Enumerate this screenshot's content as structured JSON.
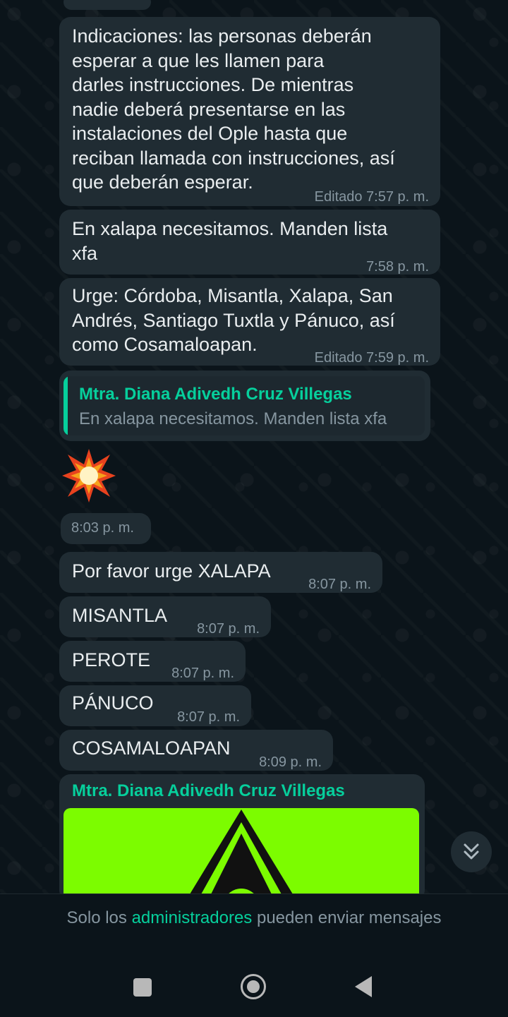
{
  "messages": [
    {
      "text": "Indicaciones: las personas deberán esperar a que les llamen para darles instrucciones. De mientras nadie deberá presentarse en las instalaciones del Ople hasta que reciban llamada con instrucciones, así que deberán esperar.",
      "lines": [
        "Indicaciones: las personas deberán",
        "esperar a que les llamen para",
        "darles instrucciones. De mientras",
        "nadie deberá presentarse en las",
        "instalaciones del Ople hasta que",
        "reciban llamada con instrucciones, así",
        "que deberán esperar."
      ],
      "time": "Editado 7:57 p. m."
    },
    {
      "lines": [
        "En xalapa necesitamos. Manden lista",
        "xfa"
      ],
      "time": "7:58 p. m."
    },
    {
      "lines": [
        "Urge: Córdoba, Misantla, Xalapa, San",
        "Andrés, Santiago Tuxtla y Pánuco, así",
        "como Cosamaloapan."
      ],
      "time": "Editado 7:59 p. m."
    }
  ],
  "reply": {
    "quoted_author": "Mtra. Diana Adivedh Cruz Villegas",
    "quoted_text": "En xalapa necesitamos. Manden lista xfa",
    "emoji": "collision-emoji",
    "time": "8:03 p. m."
  },
  "short_messages": [
    {
      "text": "Por favor urge XALAPA",
      "time": "8:07 p. m."
    },
    {
      "text": "MISANTLA",
      "time": "8:07 p. m."
    },
    {
      "text": "PEROTE",
      "time": "8:07 p. m."
    },
    {
      "text": "PÁNUCO",
      "time": "8:07 p. m."
    },
    {
      "text": "COSAMALOAPAN",
      "time": "8:09 p. m."
    }
  ],
  "media_message": {
    "author": "Mtra. Diana Adivedh Cruz Villegas",
    "image_icon": "warning-triangle-icon",
    "image_color": "#7cfc00"
  },
  "scroll_button": {
    "icon": "double-chevron-down-icon"
  },
  "footer": {
    "prefix": "Solo los ",
    "link": "administradores",
    "suffix": " pueden enviar mensajes"
  },
  "nav": {
    "recents_icon": "square-icon",
    "home_icon": "circle-icon",
    "back_icon": "back-triangle-icon"
  },
  "colors": {
    "background": "#0b141a",
    "bubble": "#202c33",
    "accent": "#06cf9c",
    "secondary_text": "#8696a0"
  }
}
